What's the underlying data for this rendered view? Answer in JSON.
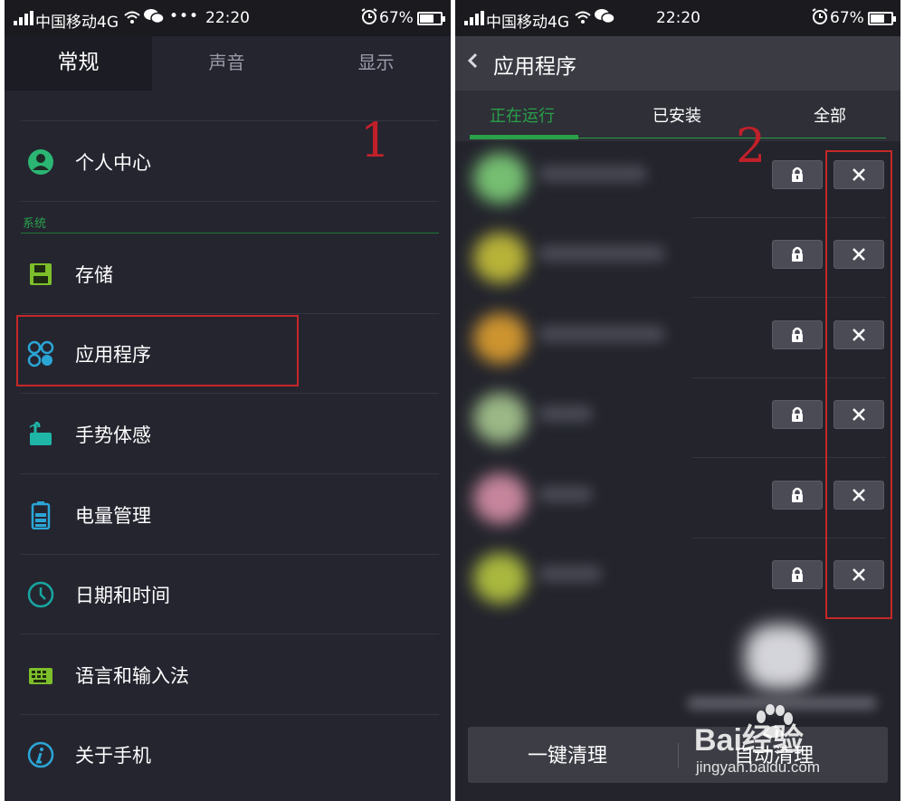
{
  "status_bar": {
    "carrier": "中国移动4G",
    "time": "22:20",
    "battery_percent": "67%",
    "battery_level": 0.67,
    "icons": [
      "signal-icon",
      "wifi-icon",
      "wechat-icon",
      "more-icon",
      "alarm-icon",
      "battery-icon"
    ]
  },
  "left": {
    "tabs": [
      {
        "label": "常规",
        "active": true
      },
      {
        "label": "声音",
        "active": false
      },
      {
        "label": "显示",
        "active": false
      }
    ],
    "section_label": "系统",
    "items": [
      {
        "label": "个人中心",
        "icon": "person-icon",
        "color": "#2bb673"
      },
      {
        "label": "存储",
        "icon": "storage-icon",
        "color": "#7dbf2a"
      },
      {
        "label": "应用程序",
        "icon": "apps-icon",
        "color": "#2aa6d6"
      },
      {
        "label": "手势体感",
        "icon": "gesture-icon",
        "color": "#1fb6a8"
      },
      {
        "label": "电量管理",
        "icon": "battery-manage-icon",
        "color": "#2aa6d6"
      },
      {
        "label": "日期和时间",
        "icon": "clock-icon",
        "color": "#17a6a0"
      },
      {
        "label": "语言和输入法",
        "icon": "keyboard-icon",
        "color": "#7dbf2a"
      },
      {
        "label": "关于手机",
        "icon": "info-icon",
        "color": "#2aa6d6"
      }
    ],
    "annotation": "1",
    "highlight_color": "#c62828"
  },
  "right": {
    "title": "应用程序",
    "tabs": [
      {
        "label": "正在运行",
        "active": true
      },
      {
        "label": "已安装",
        "active": false
      },
      {
        "label": "全部",
        "active": false
      }
    ],
    "annotation": "2",
    "rows": [
      {
        "icon_color": "#7fd07a"
      },
      {
        "icon_color": "#c8c23a"
      },
      {
        "icon_color": "#e0a030"
      },
      {
        "icon_color": "#a8c890"
      },
      {
        "icon_color": "#d890a8"
      },
      {
        "icon_color": "#b8c840"
      }
    ],
    "bottom_buttons": [
      "一键清理",
      "自动清理"
    ]
  },
  "watermark": {
    "brand": "Bai经验",
    "url": "jingyan.baidu.com"
  },
  "accent_green": "#2aa048"
}
